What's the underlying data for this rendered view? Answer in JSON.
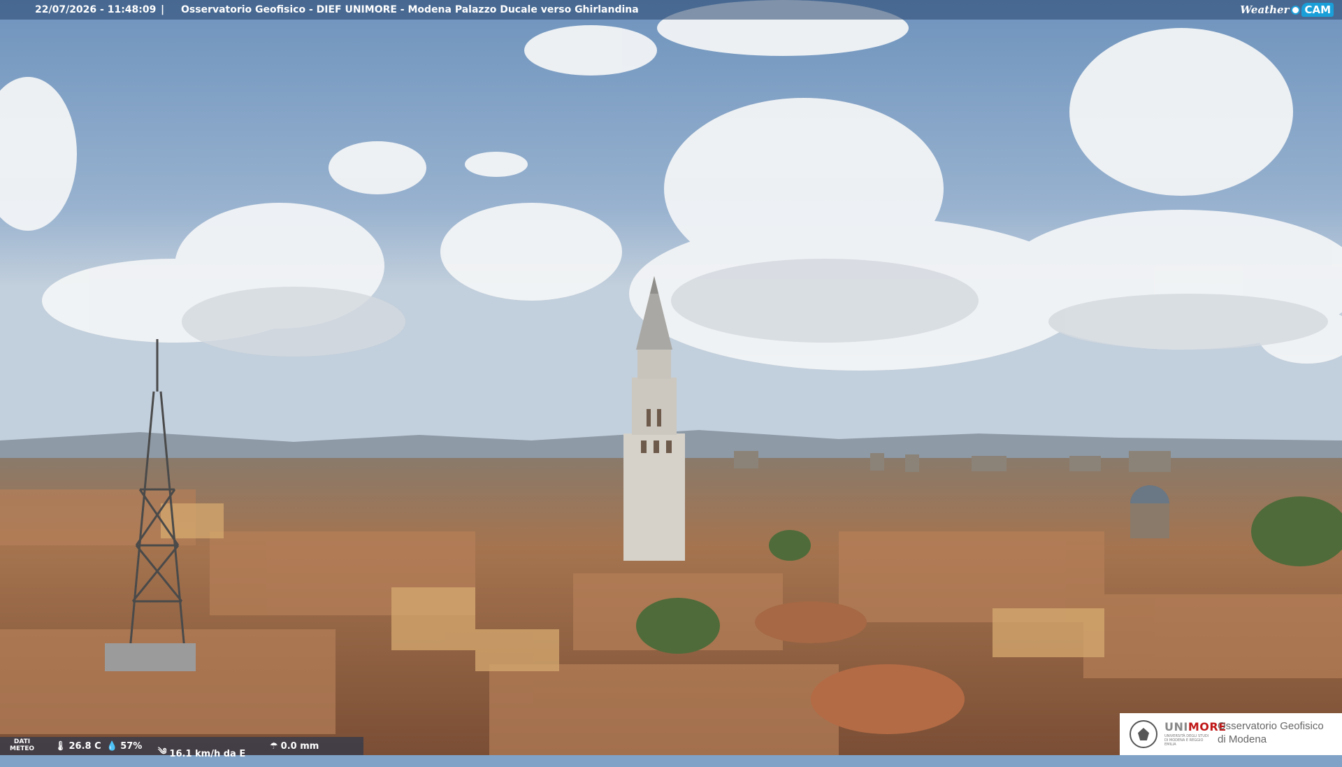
{
  "header": {
    "timestamp": "22/07/2026 - 11:48:09",
    "separator": "|",
    "title": "Osservatorio Geofisico - DIEF UNIMORE - Modena Palazzo Ducale verso Ghirlandina",
    "logo_weather": "Weather",
    "logo_cam": "CAM"
  },
  "weather": {
    "label_line1": "DATI",
    "label_line2": "METEO",
    "temperature": "26.8 C",
    "humidity": "57%",
    "wind": "16.1 km/h da E",
    "rain": "0.0 mm",
    "icons": [
      "thermometer-icon",
      "droplet-icon",
      "wind-icon",
      "rain-icon"
    ]
  },
  "branding": {
    "uni_prefix": "UNI",
    "uni_suffix": "MORE",
    "uni_subtitle": "UNIVERSITÀ DEGLI STUDI DI MODENA E REGGIO EMILIA",
    "observatory_line1": "Osservatorio Geofisico",
    "observatory_line2": "di Modena"
  },
  "colors": {
    "sky": "#7fa2c6",
    "roof": "#a06a4a",
    "brand_red": "#c01818",
    "cam_blue": "#1a9fd9"
  }
}
